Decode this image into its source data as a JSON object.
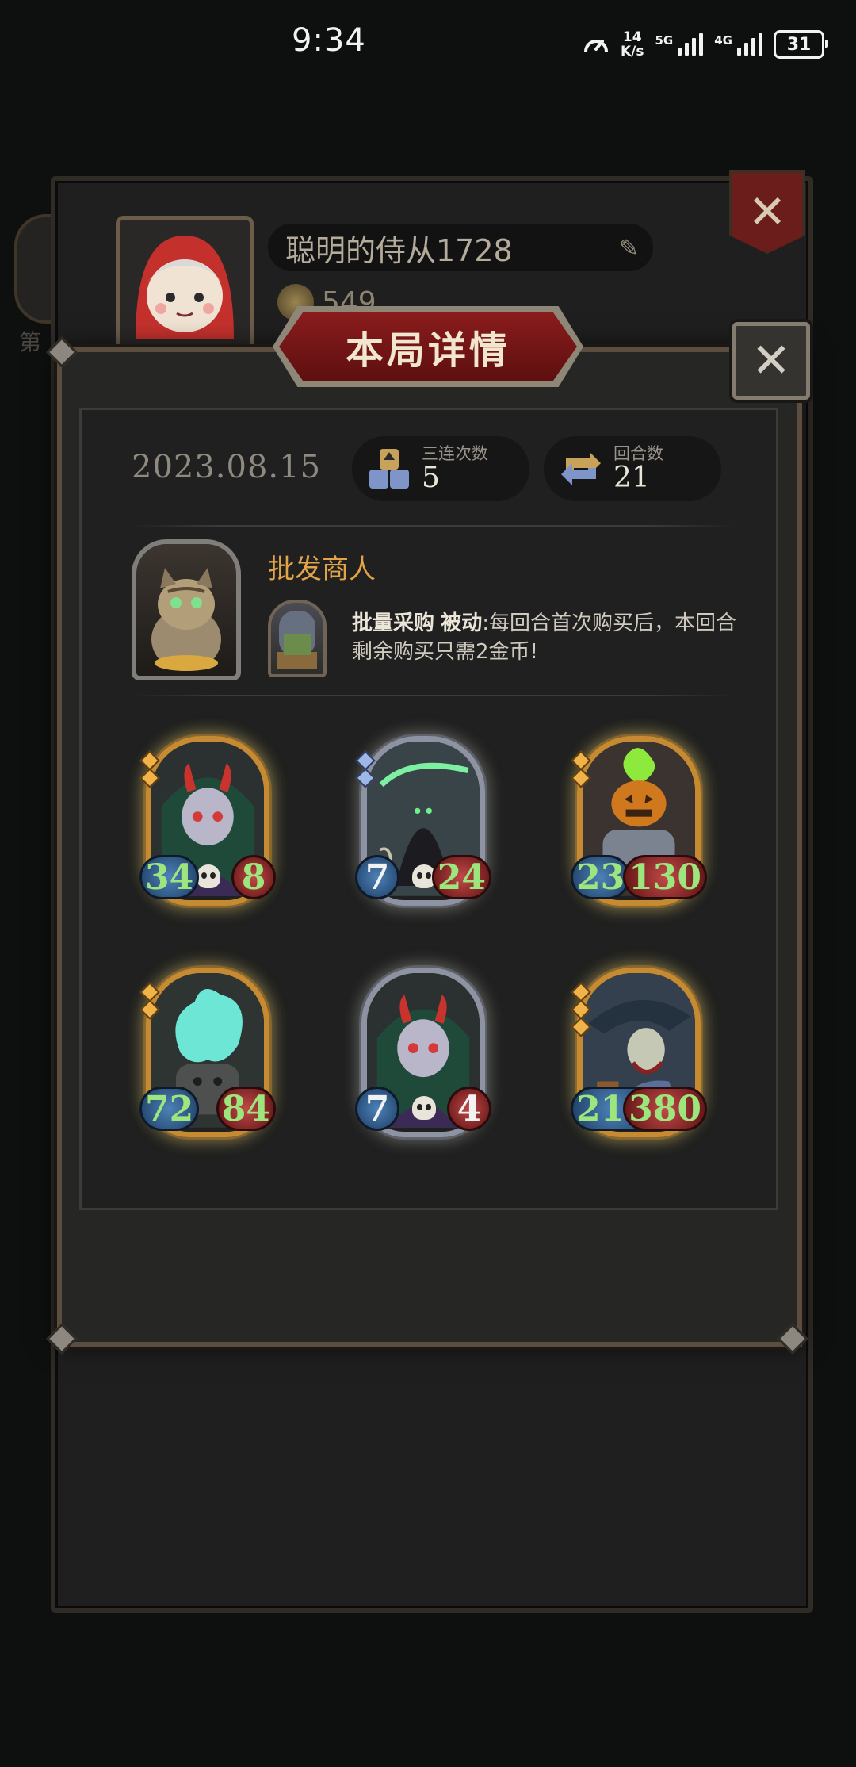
{
  "status_bar": {
    "time": "9:34",
    "net_speed_value": "14",
    "net_speed_unit": "K/s",
    "sig1_label": "5G",
    "sig2_label": "4G",
    "battery": "31"
  },
  "background_profile": {
    "player_name": "聪明的侍从1728",
    "coins": "549",
    "side_label": "第"
  },
  "detail": {
    "title": "本局详情",
    "date": "2023.08.15",
    "stats": [
      {
        "label": "三连次数",
        "value": "5",
        "icon": "triple-stack-icon"
      },
      {
        "label": "回合数",
        "value": "21",
        "icon": "refresh-arrows-icon"
      }
    ],
    "hero": {
      "name": "批发商人",
      "portrait": "cat-merchant-portrait",
      "skill_name": "批量采购",
      "skill_type": "被动",
      "skill_desc": ":每回合首次购买后，本回合剩余购买只需2金币!"
    },
    "cards": [
      {
        "attack": "34",
        "health": "8",
        "frame": "gold",
        "art": "horned-elf-girl",
        "gems": 2,
        "gem_color": "gold",
        "skull": true
      },
      {
        "attack": "7",
        "health": "24",
        "frame": "silver",
        "art": "hooded-reaper",
        "gems": 2,
        "gem_color": "blue",
        "skull": true
      },
      {
        "attack": "23",
        "health": "130",
        "frame": "gold",
        "art": "pumpkin-flame-golem",
        "gems": 2,
        "gem_color": "gold",
        "skull": true
      },
      {
        "attack": "72",
        "health": "84",
        "frame": "gold",
        "art": "blue-flame-spirit",
        "gems": 2,
        "gem_color": "gold",
        "skull": false
      },
      {
        "attack": "7",
        "health": "4",
        "frame": "silver",
        "art": "horned-elf-girl",
        "gems": 0,
        "gem_color": "blue",
        "skull": true
      },
      {
        "attack": "213",
        "health": "380",
        "frame": "gold",
        "art": "pirate-captain",
        "gems": 3,
        "gem_color": "gold",
        "skull": false
      }
    ]
  },
  "colors": {
    "accent_gold": "#e3a347",
    "title_red": "#8a1c1c",
    "stat_green": "#9de57d"
  }
}
